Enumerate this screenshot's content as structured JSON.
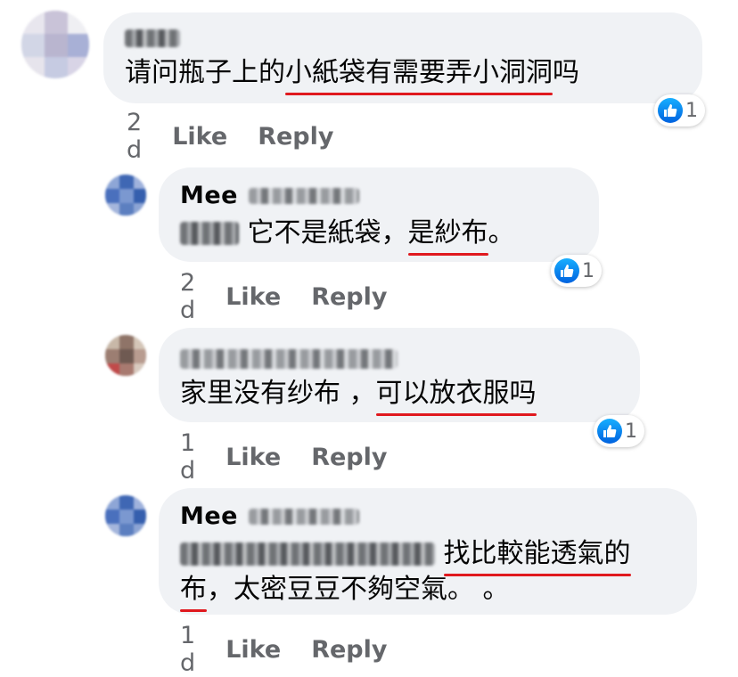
{
  "comments": [
    {
      "author_suffix": "",
      "lines": [
        {
          "pre": "请问瓶子上的",
          "ul": "小紙袋有需要弄小洞洞",
          "post": "吗"
        }
      ],
      "time": "2 d",
      "like": "Like",
      "reply": "Reply",
      "reactions": "1"
    },
    {
      "author_first": "Mee",
      "lines": [
        {
          "pre": " 它不是紙袋，",
          "ul": "是紗布",
          "post": "。"
        }
      ],
      "time": "2 d",
      "like": "Like",
      "reply": "Reply",
      "reactions": "1"
    },
    {
      "lines": [
        {
          "pre": "家里没有纱布 ，",
          "ul": "可以放衣服吗",
          "post": ""
        }
      ],
      "time": "1 d",
      "like": "Like",
      "reply": "Reply",
      "reactions": "1"
    },
    {
      "author_first": "Mee",
      "lines": [
        {
          "pre": " ",
          "ul": "找比較能透氣的",
          "post": ""
        },
        {
          "pre": "",
          "ul": "布",
          "post": "，太密豆豆不夠空氣。 。"
        }
      ],
      "time": "1 d",
      "like": "Like",
      "reply": "Reply"
    }
  ],
  "colors": {
    "bubble": "#f0f2f5",
    "underline": "#e0191e",
    "like_blue": "#0062df",
    "meta": "#65676b"
  },
  "icons": {
    "reaction": "thumbs-up-icon"
  }
}
